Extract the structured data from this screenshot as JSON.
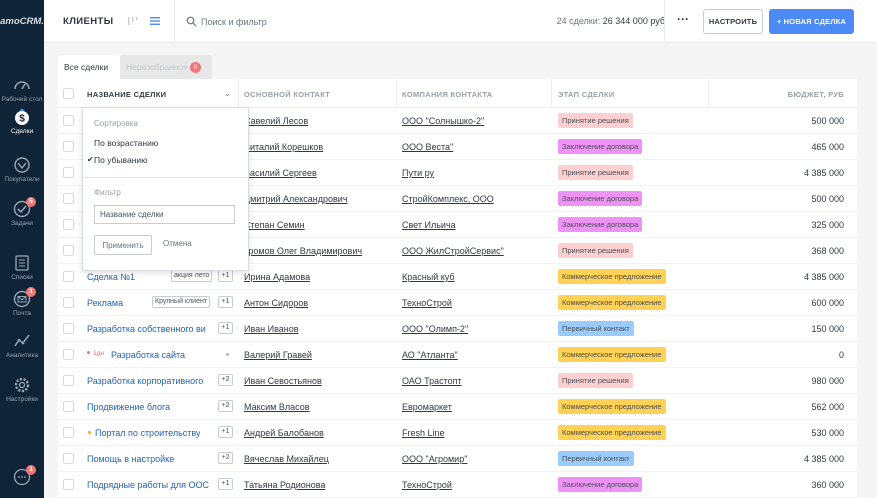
{
  "app": {
    "logo_text": "amoCRM."
  },
  "nav": [
    {
      "label": "Рабочий стол",
      "icon": "dashboard-gauge-icon",
      "badge": ""
    },
    {
      "label": "Сделки",
      "icon": "deals-dollar-icon",
      "badge": "",
      "active": true
    },
    {
      "label": "Покупатели",
      "icon": "customers-icon",
      "badge": ""
    },
    {
      "label": "Задачи",
      "icon": "tasks-check-icon",
      "badge": "5"
    },
    {
      "label": "Списки",
      "icon": "lists-icon",
      "badge": ""
    },
    {
      "label": "Почта",
      "icon": "mail-icon",
      "badge": "1"
    },
    {
      "label": "Аналитика",
      "icon": "analytics-icon",
      "badge": ""
    },
    {
      "label": "Настройки",
      "icon": "settings-gear-icon",
      "badge": ""
    }
  ],
  "chat_badge": "1",
  "header": {
    "title": "КЛИЕНТЫ",
    "search_placeholder": "Поиск и фильтр",
    "deals_count": "24 сделки:",
    "deals_total": "26 344 000 руб",
    "more": "···",
    "configure_label": "НАСТРОИТЬ",
    "new_deal_label": "+ НОВАЯ СДЕЛКА"
  },
  "tabs": {
    "all": "Все сделки",
    "unsorted": "Неразобранное",
    "unsorted_count": "0"
  },
  "columns": {
    "name": "НАЗВАНИЕ СДЕЛКИ",
    "contact": "ОСНОВНОЙ КОНТАКТ",
    "company": "КОМПАНИЯ КОНТАКТА",
    "stage": "ЭТАП СДЕЛКИ",
    "budget": "БЮДЖЕТ, РУБ"
  },
  "stage_colors": {
    "Принятие решения": "#fcd0d0",
    "Заключение договора": "#ee93f5",
    "Коммерческое предложение": "#ffd155",
    "Первичный контакт": "#99ccfc"
  },
  "rows": [
    {
      "name": "",
      "tag": "",
      "plus": "",
      "contact": "Савелий Лесов",
      "company": "ООО \"Солнышко-2\"",
      "stage": "Принятие решения",
      "budget": "500 000"
    },
    {
      "name": "",
      "tag": "",
      "plus": "",
      "contact": "Виталий Корешков",
      "company": "ООО Веста\"",
      "stage": "Заключение договора",
      "budget": "465 000"
    },
    {
      "name": "",
      "tag": "",
      "plus": "",
      "contact": "Василий Сергеев",
      "company": "Пути ру",
      "stage": "Принятие решения",
      "budget": "4 385 000"
    },
    {
      "name": "",
      "tag": "",
      "plus": "",
      "contact": "Дмитрий Александрович",
      "company": "СтройКомплекс, ООО",
      "stage": "Заключение договора",
      "budget": "500 000"
    },
    {
      "name": "",
      "tag": "",
      "plus": "",
      "contact": "Степан Семин",
      "company": "Свет Ильича",
      "stage": "Заключение договора",
      "budget": "325 000"
    },
    {
      "name": "",
      "tag": "",
      "plus": "",
      "contact": "Громов Олег Владимирович",
      "company": "ООО ЖилСтройСервис\"",
      "stage": "Принятие решения",
      "budget": "368 000"
    },
    {
      "name": "Сделка №1",
      "tag": "акция лето",
      "plus": "+1",
      "contact": "Ирина Адамова",
      "company": "Красный куб",
      "stage": "Коммерческое предложение",
      "budget": "4 385 000"
    },
    {
      "name": "Реклама",
      "tag": "Крупный клиент",
      "plus": "+1",
      "contact": "Антон Сидоров",
      "company": "ТехноСтрой",
      "stage": "Коммерческое предложение",
      "budget": "600 000"
    },
    {
      "name": "Разработка собственного ви",
      "tag": "",
      "plus": "+1",
      "contact": "Иван Иванов",
      "company": "ООО \"Олимп-2\"",
      "stage": "Первичный контакт",
      "budget": "150 000"
    },
    {
      "name": "Разработка сайта",
      "pre": "1дн",
      "pre_color": "#f37575",
      "tag": "",
      "plus": "",
      "dot": true,
      "contact": "Валерий Гравей",
      "company": "АО \"Атланта\"",
      "stage": "Коммерческое предложение",
      "budget": "0"
    },
    {
      "name": "Разработка корпоративного",
      "tag": "",
      "plus": "+2",
      "contact": "Иван Севостьянов",
      "company": "ОАО Трастопт",
      "stage": "Принятие решения",
      "budget": "980 000"
    },
    {
      "name": "Продвижение блога",
      "tag": "",
      "plus": "+2",
      "contact": "Максим Власов",
      "company": "Евромаркет",
      "stage": "Коммерческое предложение",
      "budget": "562 000"
    },
    {
      "name": "Портал по строительству",
      "pre_dot": "#f5a623",
      "tag": "",
      "plus": "+1",
      "contact": "Андрей Балобанов",
      "company": "Fresh Line",
      "stage": "Коммерческое предложение",
      "budget": "530 000"
    },
    {
      "name": "Помощь в настройке",
      "tag": "",
      "plus": "+2",
      "contact": "Вячеслав Михайлец",
      "company": "ООО \"Агромир\"",
      "stage": "Первичный контакт",
      "budget": "4 385 000"
    },
    {
      "name": "Подрядные работы для ООС",
      "tag": "",
      "plus": "+1",
      "contact": "Татьяна Родионова",
      "company": "ТехноСтрой",
      "stage": "Заключение договора",
      "budget": "360 000"
    }
  ],
  "sort_dropdown": {
    "sort_title": "Сортировка",
    "asc": "По возрастанию",
    "desc": "По убыванию",
    "selected": "desc",
    "filter_title": "Фильтр",
    "filter_placeholder": "Название сделки",
    "apply_label": "Применить",
    "cancel_label": "Отмена"
  }
}
